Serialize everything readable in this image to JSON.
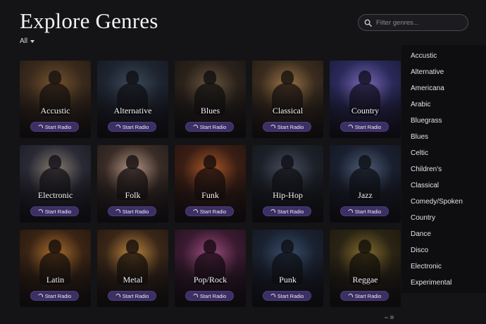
{
  "header": {
    "title": "Explore Genres",
    "filter_label": "All"
  },
  "search": {
    "placeholder": "Filter genres..."
  },
  "radio_label": "Start Radio",
  "cards": [
    {
      "label": "Accustic",
      "colors": [
        "#3a2a1c",
        "#7a5530",
        "#1a140f"
      ]
    },
    {
      "label": "Alternative",
      "colors": [
        "#1e2530",
        "#3e4a5c",
        "#101216"
      ]
    },
    {
      "label": "Blues",
      "colors": [
        "#2a211a",
        "#6b5840",
        "#121010"
      ]
    },
    {
      "label": "Classical",
      "colors": [
        "#3a2c1e",
        "#a07848",
        "#1a1410"
      ]
    },
    {
      "label": "Country",
      "colors": [
        "#2a2a5a",
        "#7d6bb8",
        "#141228"
      ]
    },
    {
      "label": "Electronic",
      "colors": [
        "#2a2a36",
        "#8a8070",
        "#15141a"
      ]
    },
    {
      "label": "Folk",
      "colors": [
        "#3a2c26",
        "#b89a88",
        "#1a1414"
      ]
    },
    {
      "label": "Funk",
      "colors": [
        "#3a1e14",
        "#b05a2a",
        "#1a0f0c"
      ]
    },
    {
      "label": "Hip-Hop",
      "colors": [
        "#1c2028",
        "#4a5060",
        "#101216"
      ]
    },
    {
      "label": "Jazz",
      "colors": [
        "#1a2030",
        "#50607a",
        "#0f1218"
      ]
    },
    {
      "label": "Latin",
      "colors": [
        "#3a2414",
        "#b07030",
        "#1a110b"
      ]
    },
    {
      "label": "Metal",
      "colors": [
        "#3a2618",
        "#c08a40",
        "#1a120c"
      ]
    },
    {
      "label": "Pop/Rock",
      "colors": [
        "#3a1a30",
        "#a05080",
        "#1a0c16"
      ]
    },
    {
      "label": "Punk",
      "colors": [
        "#1a2230",
        "#3a5070",
        "#0f1218"
      ]
    },
    {
      "label": "Reggae",
      "colors": [
        "#2a2414",
        "#8a7030",
        "#15120a"
      ]
    }
  ],
  "sidebar": {
    "items": [
      "Accustic",
      "Alternative",
      "Americana",
      "Arabic",
      "Bluegrass",
      "Blues",
      "Celtic",
      "Children's",
      "Classical",
      "Comedy/Spoken",
      "Country",
      "Dance",
      "Disco",
      "Electronic",
      "Experimental"
    ]
  },
  "colors": {
    "button_bg": "#3b2f63",
    "page_bg": "#141316"
  }
}
